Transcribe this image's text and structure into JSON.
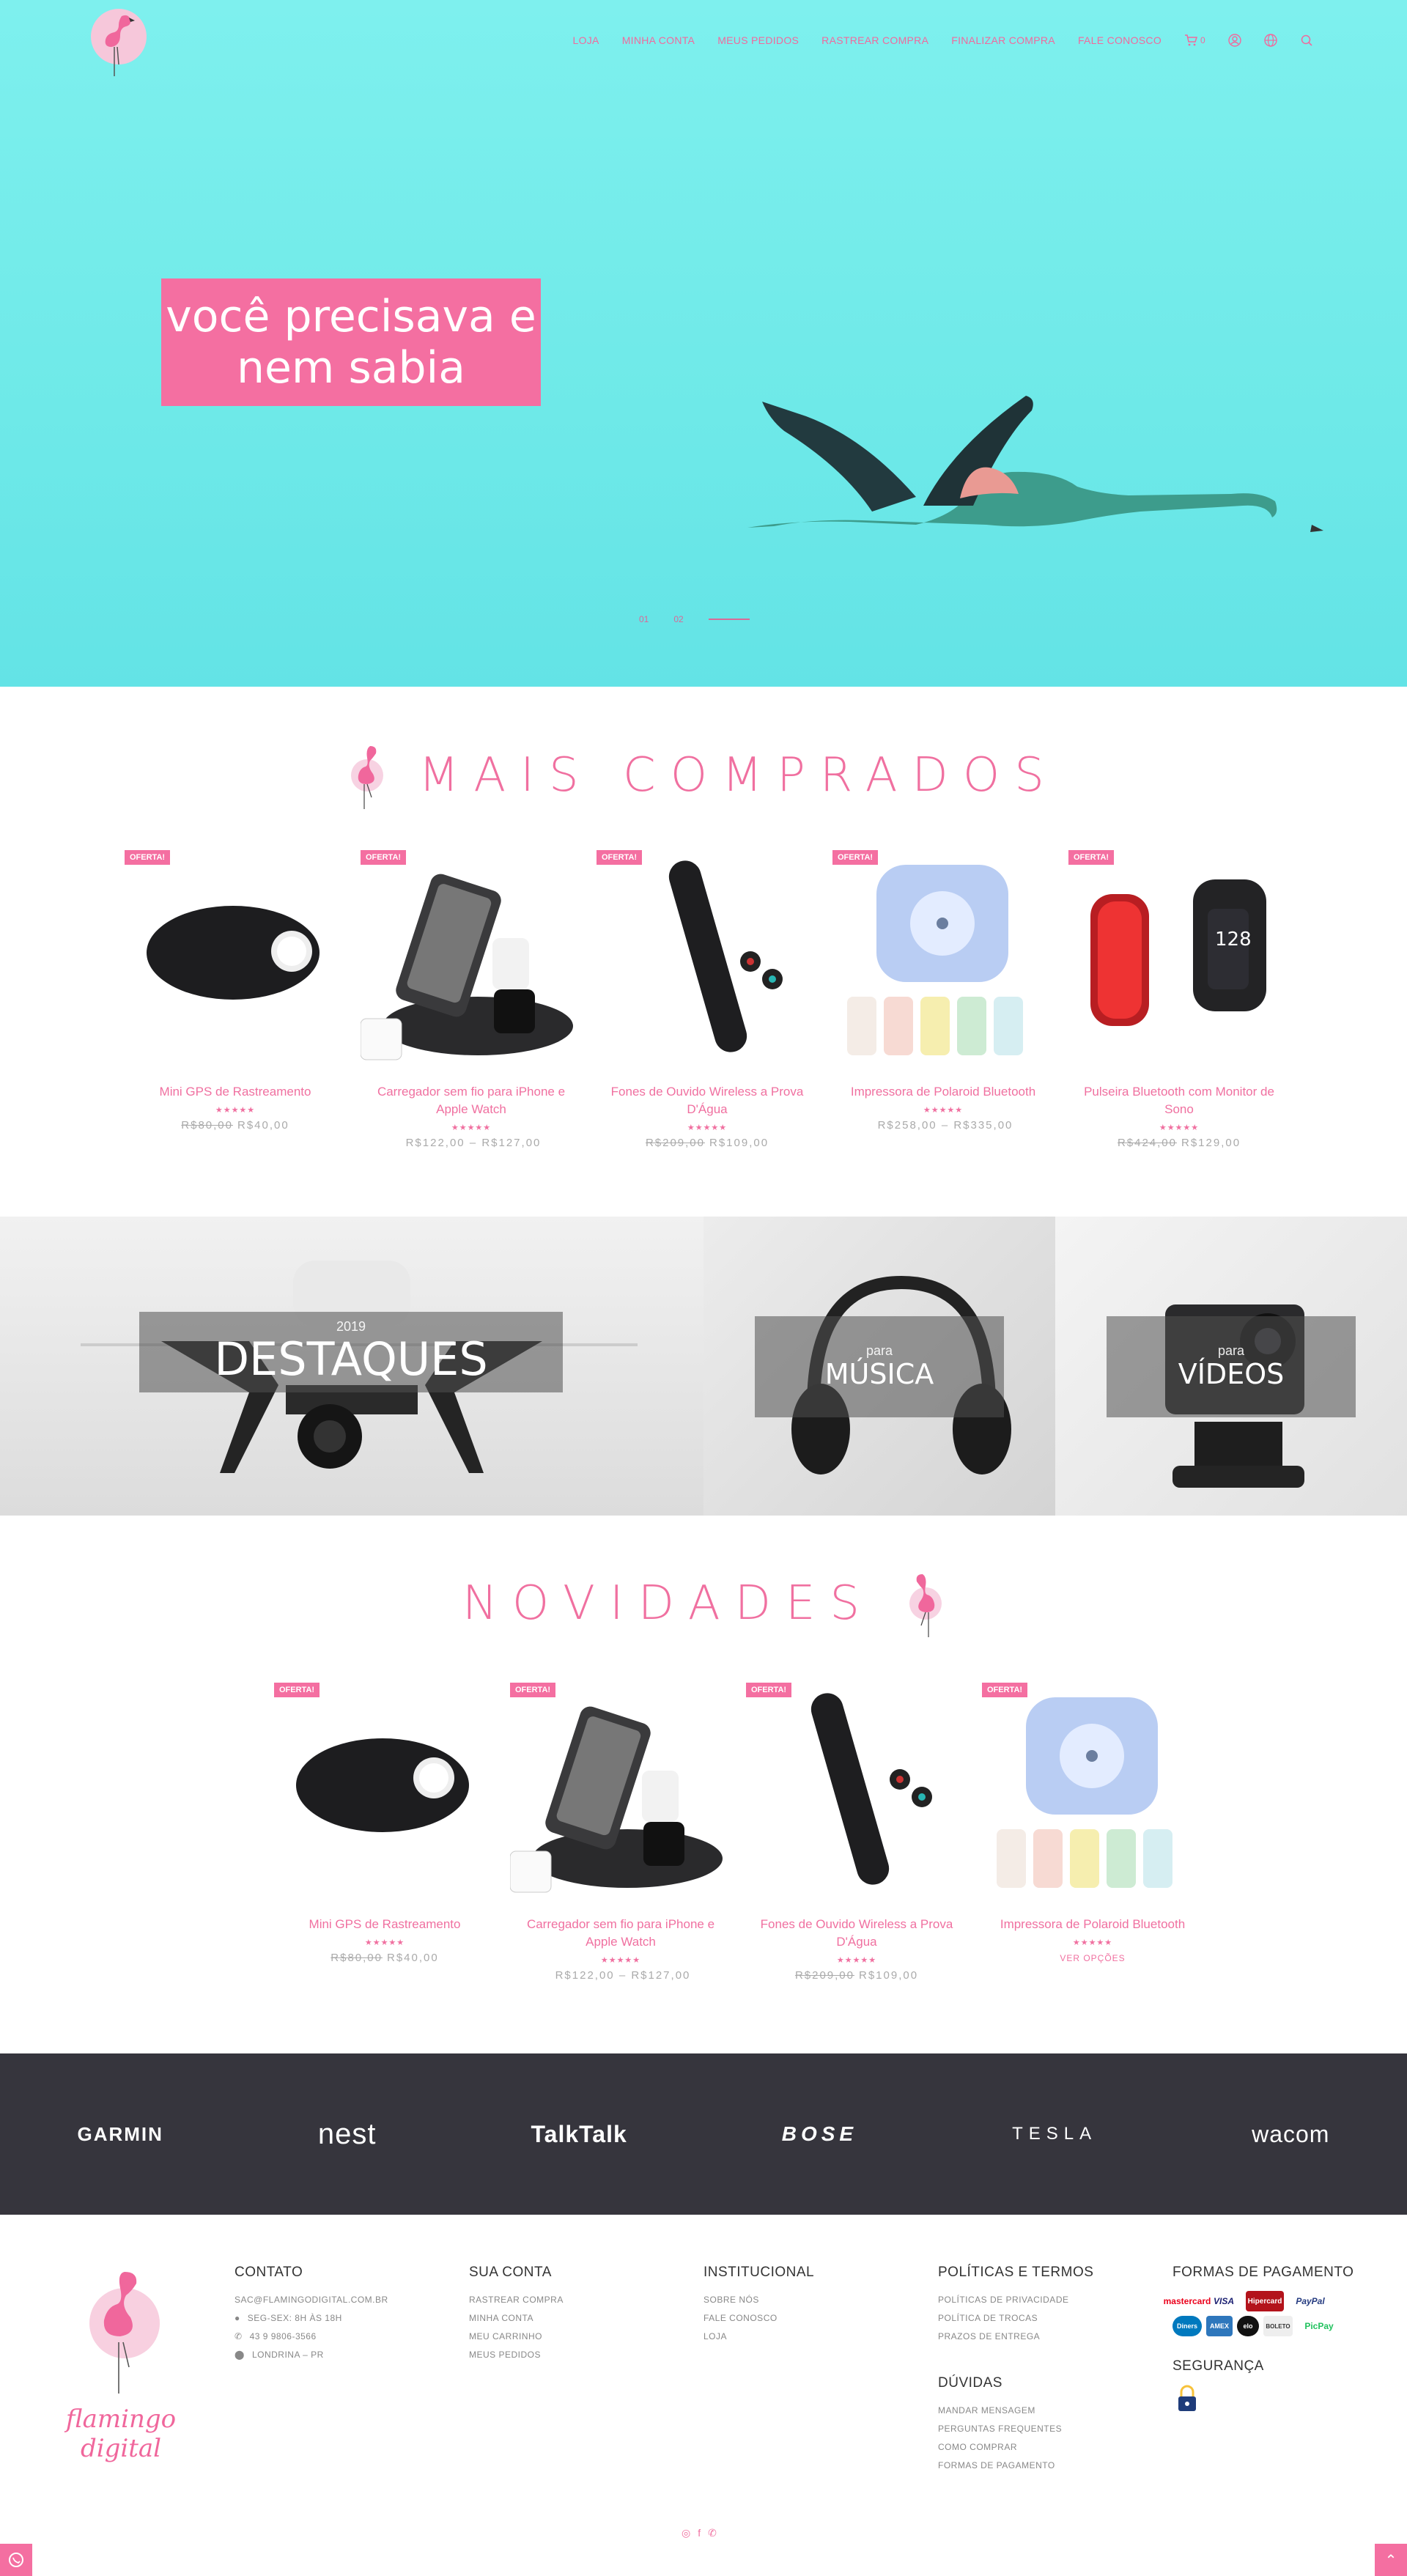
{
  "nav": {
    "items": [
      "LOJA",
      "MINHA CONTA",
      "MEUS PEDIDOS",
      "RASTREAR COMPRA",
      "FINALIZAR COMPRA",
      "FALE CONOSCO"
    ],
    "cart_count": "0",
    "icons": [
      "cart-icon",
      "user-icon",
      "globe-icon",
      "search-icon"
    ]
  },
  "hero": {
    "line1": "você precisava e",
    "line2": "nem sabia",
    "dot1": "01",
    "dot2": "02"
  },
  "best_sellers": {
    "title": "MAIS COMPRADOS",
    "products": [
      {
        "badge": "OFERTA!",
        "name": "Mini GPS de Rastreamento",
        "stars": "★★★★★",
        "old_price": "R$80,00",
        "price": "R$40,00"
      },
      {
        "badge": "OFERTA!",
        "name": "Carregador sem fio para iPhone e Apple Watch",
        "stars": "★★★★★",
        "old_price": "",
        "price": "R$122,00 – R$127,00"
      },
      {
        "badge": "OFERTA!",
        "name": "Fones de Ouvido Wireless a Prova D'Água",
        "stars": "★★★★★",
        "old_price": "R$209,00",
        "price": "R$109,00"
      },
      {
        "badge": "OFERTA!",
        "name": "Impressora de Polaroid Bluetooth",
        "stars": "★★★★★",
        "old_price": "",
        "price": "R$258,00 – R$335,00"
      },
      {
        "badge": "OFERTA!",
        "name": "Pulseira Bluetooth com Monitor de Sono",
        "stars": "★★★★★",
        "old_price": "R$424,00",
        "price": "R$129,00"
      }
    ]
  },
  "banners": {
    "highlights_year": "2019",
    "highlights": "DESTAQUES",
    "music_pre": "para",
    "music": "MÚSICA",
    "videos_pre": "para",
    "videos": "VÍDEOS"
  },
  "new_arrivals": {
    "title": "NOVIDADES",
    "products": [
      {
        "badge": "OFERTA!",
        "name": "Mini GPS de Rastreamento",
        "stars": "★★★★★",
        "old_price": "R$80,00",
        "price": "R$40,00"
      },
      {
        "badge": "OFERTA!",
        "name": "Carregador sem fio para iPhone e Apple Watch",
        "stars": "★★★★★",
        "old_price": "",
        "price": "R$122,00 – R$127,00"
      },
      {
        "badge": "OFERTA!",
        "name": "Fones de Ouvido Wireless a Prova D'Água",
        "stars": "★★★★★",
        "old_price": "R$209,00",
        "price": "R$109,00"
      },
      {
        "badge": "OFERTA!",
        "name": "Impressora de Polaroid Bluetooth",
        "stars": "★★★★★",
        "old_price": "",
        "price": "",
        "view": "VER OPÇÕES"
      }
    ]
  },
  "brands": [
    "GARMIN",
    "nest",
    "TalkTalk",
    "BOSE",
    "TESLA",
    "wacom"
  ],
  "footer": {
    "logo_text": "flamingo digital",
    "contact": {
      "title": "CONTATO",
      "email": "SAC@FLAMINGODIGITAL.COM.BR",
      "hours": "SEG-SEX: 8H ÀS 18H",
      "phone": "43 9 9806-3566",
      "city": "LONDRINA – PR"
    },
    "account": {
      "title": "SUA CONTA",
      "items": [
        "RASTREAR COMPRA",
        "MINHA CONTA",
        "MEU CARRINHO",
        "MEUS PEDIDOS"
      ]
    },
    "institutional": {
      "title": "INSTITUCIONAL",
      "items": [
        "SOBRE NÓS",
        "FALE CONOSCO",
        "LOJA"
      ]
    },
    "policies": {
      "title": "POLÍTICAS E TERMOS",
      "items": [
        "POLÍTICAS DE PRIVACIDADE",
        "POLÍTICA DE TROCAS",
        "PRAZOS DE ENTREGA"
      ]
    },
    "doubts": {
      "title": "DÚVIDAS",
      "items": [
        "MANDAR MENSAGEM",
        "PERGUNTAS FREQUENTES",
        "COMO COMPRAR",
        "FORMAS DE PAGAMENTO"
      ]
    },
    "payment": {
      "title": "FORMAS DE PAGAMENTO",
      "cards": [
        "mastercard",
        "VISA",
        "Hipercard",
        "PayPal",
        "Diners",
        "AMEX",
        "elo",
        "BOLETO",
        "PicPay"
      ]
    },
    "security": {
      "title": "SEGURANÇA"
    }
  },
  "colors": {
    "accent": "#f46fa1",
    "hero_bg": "#6ee9e8",
    "brand_bar": "#36353d"
  }
}
